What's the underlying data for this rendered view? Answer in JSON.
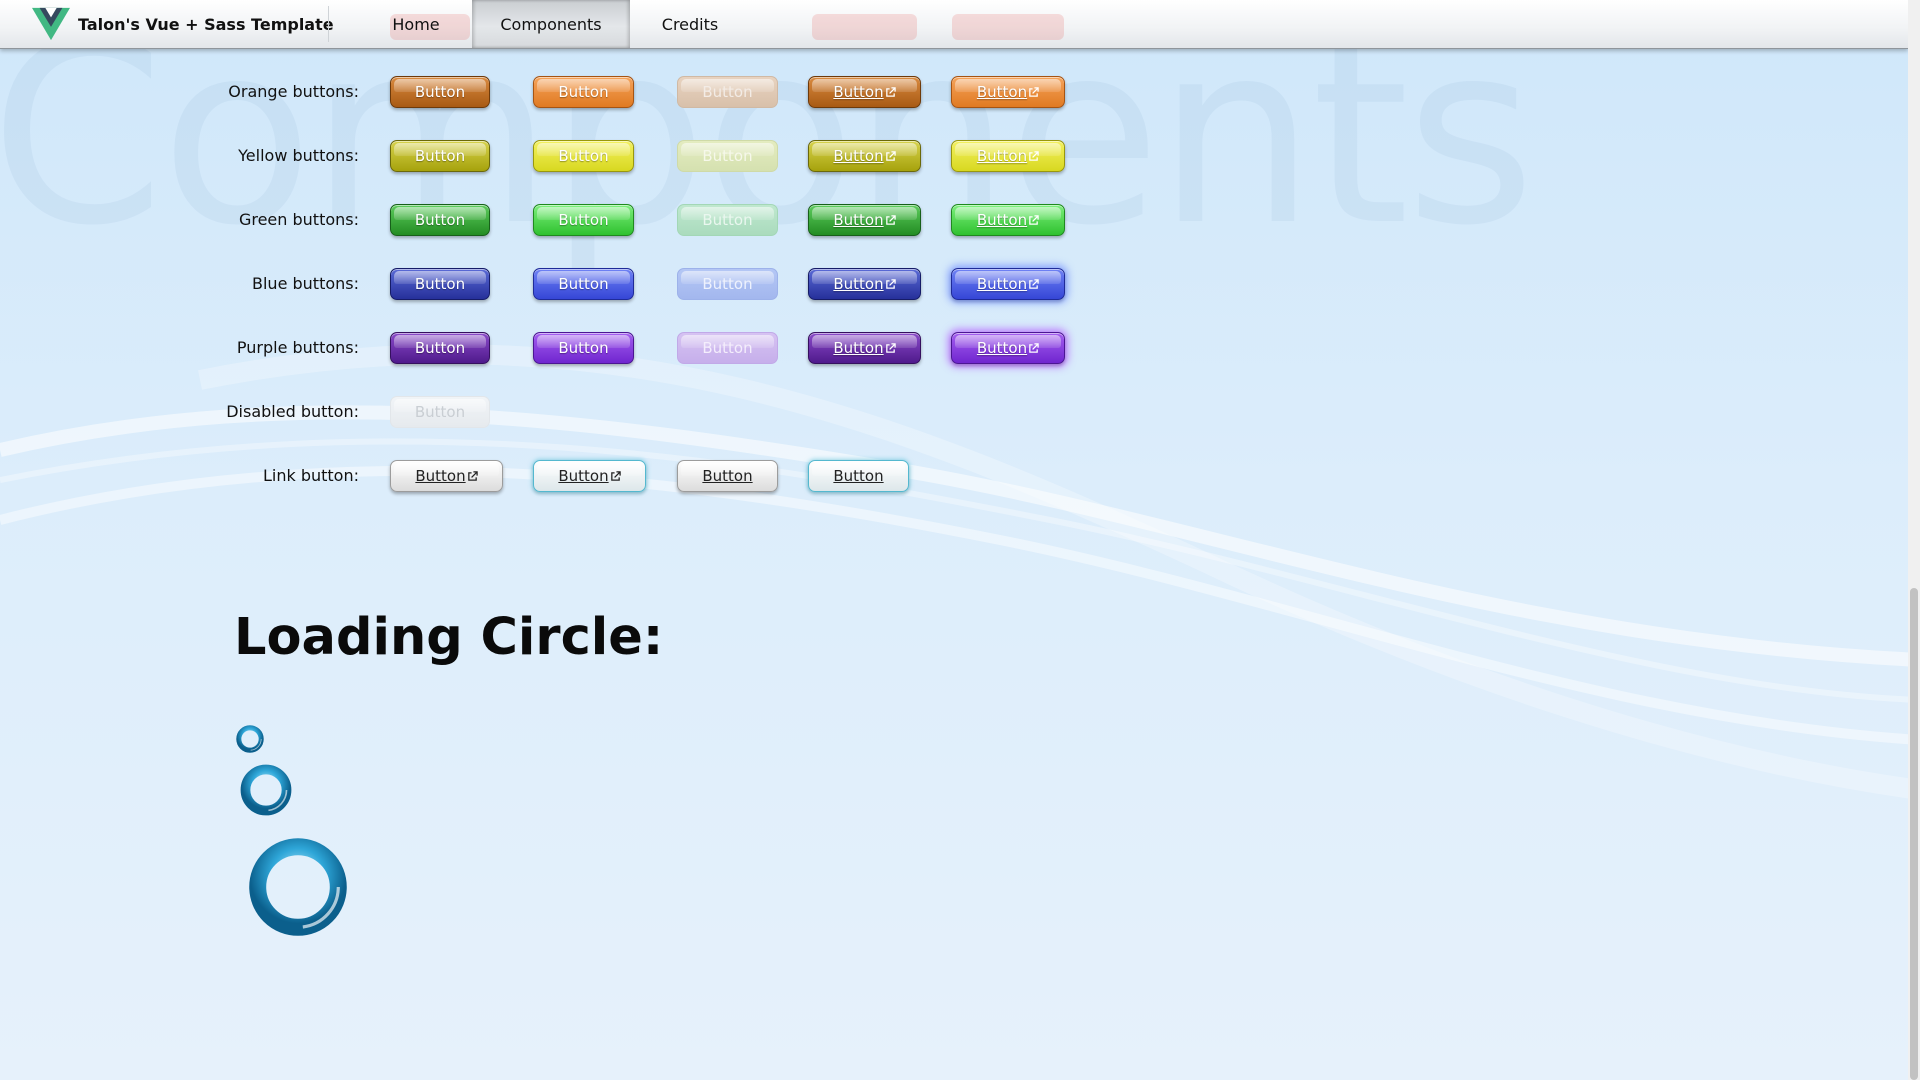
{
  "app": {
    "title": "Talon's Vue + Sass Template"
  },
  "nav": {
    "items": [
      {
        "label": "Home"
      },
      {
        "label": "Components"
      },
      {
        "label": "Credits"
      }
    ]
  },
  "watermark": "Components",
  "rows": [
    {
      "label": "Orange buttons:",
      "buttons": [
        "Button",
        "Button",
        "Button",
        "Button",
        "Button"
      ]
    },
    {
      "label": "Yellow buttons:",
      "buttons": [
        "Button",
        "Button",
        "Button",
        "Button",
        "Button"
      ]
    },
    {
      "label": "Green buttons:",
      "buttons": [
        "Button",
        "Button",
        "Button",
        "Button",
        "Button"
      ]
    },
    {
      "label": "Blue buttons:",
      "buttons": [
        "Button",
        "Button",
        "Button",
        "Button",
        "Button"
      ]
    },
    {
      "label": "Purple buttons:",
      "buttons": [
        "Button",
        "Button",
        "Button",
        "Button",
        "Button"
      ]
    },
    {
      "label": "Disabled button:",
      "buttons": [
        "Button"
      ]
    },
    {
      "label": "Link button:",
      "buttons": [
        "Button",
        "Button",
        "Button",
        "Button"
      ]
    }
  ],
  "loading": {
    "title": "Loading Circle:"
  },
  "colors": {
    "orange": "#e07a22",
    "yellow": "#d8d820",
    "green": "#2fb52f",
    "blue": "#3a4fd6",
    "purple": "#7b2bd3",
    "vue_green": "#41b883",
    "vue_dark": "#35495e"
  }
}
